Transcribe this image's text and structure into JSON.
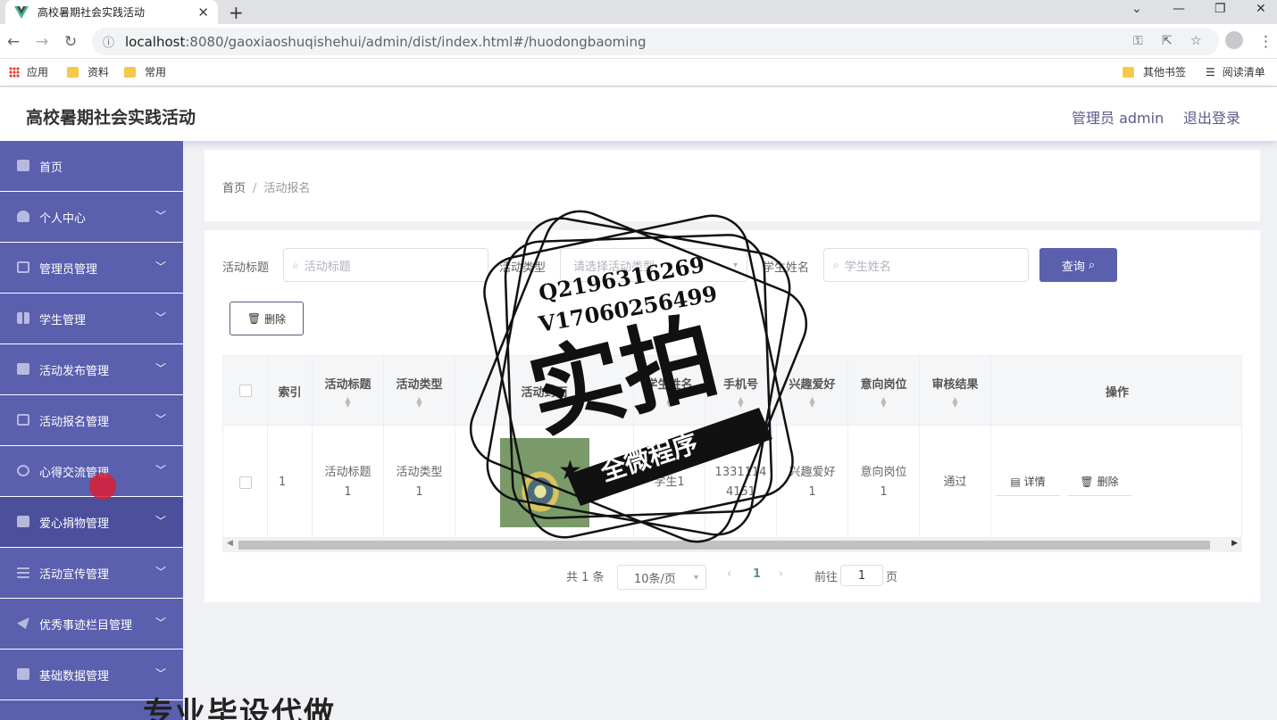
{
  "browser": {
    "tab_title": "高校暑期社会实践活动",
    "url_host": "localhost",
    "url_rest": ":8080/gaoxiaoshuqishehui/admin/dist/index.html#/huodongbaoming",
    "bookmarks": [
      "应用",
      "资料",
      "常用",
      "其他书签",
      "阅读清单"
    ]
  },
  "header": {
    "title": "高校暑期社会实践活动",
    "admin": "管理员 admin",
    "logout": "退出登录"
  },
  "sidebar": {
    "items": [
      {
        "label": "首页",
        "icon": "home-icon"
      },
      {
        "label": "个人中心",
        "icon": "user-icon"
      },
      {
        "label": "管理员管理",
        "icon": "crop-icon"
      },
      {
        "label": "学生管理",
        "icon": "grid-icon"
      },
      {
        "label": "活动发布管理",
        "icon": "chart-icon"
      },
      {
        "label": "活动报名管理",
        "icon": "mail-icon"
      },
      {
        "label": "心得交流管理",
        "icon": "compass-icon"
      },
      {
        "label": "爱心捐物管理",
        "icon": "ticket-icon"
      },
      {
        "label": "活动宣传管理",
        "icon": "sliders-icon"
      },
      {
        "label": "优秀事迹栏目管理",
        "icon": "send-icon"
      },
      {
        "label": "基础数据管理",
        "icon": "chart-icon"
      }
    ],
    "active_index": 7
  },
  "breadcrumb": {
    "home": "首页",
    "current": "活动报名"
  },
  "filters": {
    "title_label": "活动标题",
    "title_placeholder": "活动标题",
    "type_label": "活动类型",
    "type_placeholder": "请选择活动类型",
    "student_label": "学生姓名",
    "student_placeholder": "学生姓名",
    "query_label": "查询"
  },
  "toolbar": {
    "delete_label": "删除"
  },
  "table": {
    "headers": [
      "索引",
      "活动标题",
      "活动类型",
      "活动封面",
      "学生姓名",
      "手机号",
      "兴趣爱好",
      "意向岗位",
      "审核结果",
      "操作"
    ],
    "rows": [
      {
        "index": "1",
        "title": "活动标题1",
        "type": "活动类型1",
        "student": "学生1",
        "phone": "13311144151",
        "hobby": "兴趣爱好1",
        "position": "意向岗位1",
        "result": "通过"
      }
    ],
    "detail_label": "详情",
    "delete_label": "删除"
  },
  "pagination": {
    "total": "共 1 条",
    "page_size": "10条/页",
    "current_page": "1",
    "goto_prefix": "前往",
    "goto_value": "1",
    "goto_suffix": "页"
  },
  "watermark": {
    "line1": "Q2196316269",
    "line2": "V17060256499",
    "big": "实拍",
    "banner": "全微程序",
    "bottom": "专业毕设代做"
  },
  "colors": {
    "accent": "#5a5fae",
    "sidebar_active": "#4b4f9c"
  }
}
